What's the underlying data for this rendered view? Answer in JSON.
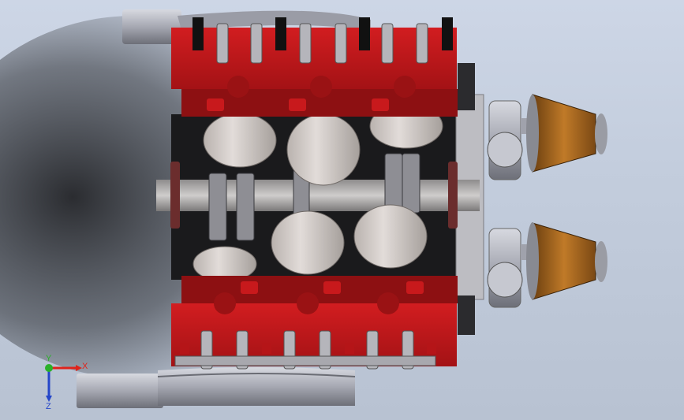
{
  "viewport": {
    "background_top": "#cdd6e6",
    "background_bottom": "#b8c2d2"
  },
  "colors": {
    "head_red": "#c8191c",
    "head_red_dark": "#8d1012",
    "piston_grey": "#d8d2cf",
    "metal_grey": "#a9a9ad",
    "filter_orange": "#b36b1f",
    "block_dark": "#1a1a1c"
  },
  "triad": {
    "x_label": "X",
    "y_label": "Y",
    "z_label": "Z",
    "x_color": "#e0231b",
    "y_color": "#2bb12a",
    "z_color": "#2546c9"
  },
  "icons": [
    "coordinate-triad-icon"
  ]
}
